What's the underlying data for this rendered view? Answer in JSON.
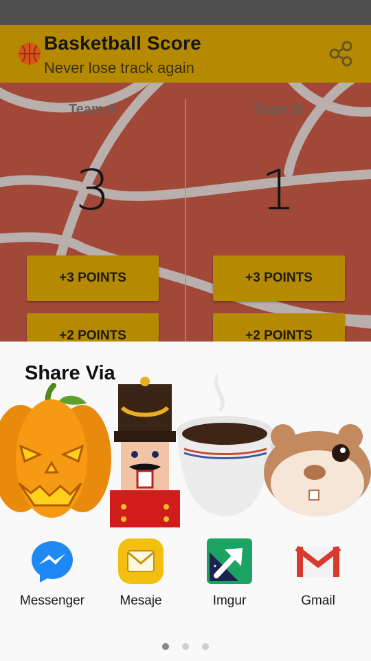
{
  "app": {
    "title": "Basketball Score",
    "subtitle": "Never lose track again",
    "accent": "#b58a00",
    "icons": [
      "basketball-icon",
      "share-icon"
    ]
  },
  "teams": [
    {
      "name": "Team A",
      "score": "3",
      "btn3": "+3 POINTS",
      "btn2": "+2 POINTS"
    },
    {
      "name": "Team B",
      "score": "1",
      "btn3": "+3 POINTS",
      "btn2": "+2 POINTS"
    }
  ],
  "share": {
    "title": "Share Via",
    "stickers": [
      "pumpkin",
      "nutcracker",
      "coffee-cup",
      "hamster"
    ],
    "targets": [
      {
        "label": "Messenger",
        "icon": "messenger-icon"
      },
      {
        "label": "Mesaje",
        "icon": "messages-icon"
      },
      {
        "label": "Imgur",
        "icon": "imgur-icon"
      },
      {
        "label": "Gmail",
        "icon": "gmail-icon"
      }
    ],
    "pages": 3,
    "active_page": 1
  },
  "colors": {
    "court": "#a24838",
    "court_lines": "#b9b0ad",
    "sheet": "#f9f9f9"
  }
}
